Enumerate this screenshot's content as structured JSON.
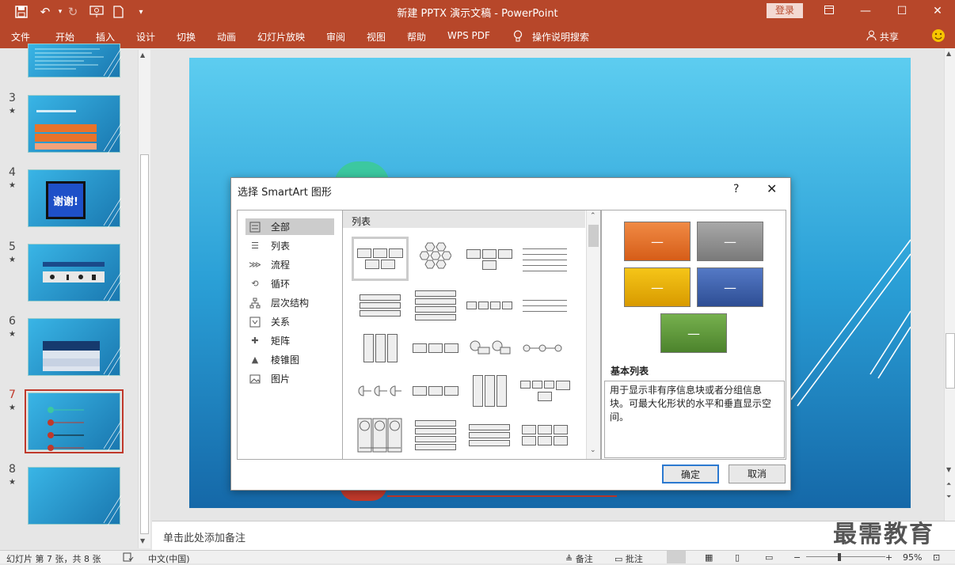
{
  "window": {
    "title": "新建 PPTX 演示文稿 - PowerPoint",
    "login_label": "登录",
    "controls": [
      "ribbon-display-icon",
      "minimize-icon",
      "maximize-icon",
      "close-icon"
    ]
  },
  "quick_access": [
    "save-icon",
    "undo-icon",
    "redo-icon",
    "present-icon",
    "new-icon",
    "customize-icon"
  ],
  "ribbon": {
    "tabs": [
      "文件",
      "开始",
      "插入",
      "设计",
      "切换",
      "动画",
      "幻灯片放映",
      "审阅",
      "视图",
      "帮助",
      "WPS PDF"
    ],
    "search_label": "操作说明搜索",
    "share_label": "共享"
  },
  "slides": [
    {
      "number": "",
      "star": ""
    },
    {
      "number": "3",
      "star": "★"
    },
    {
      "number": "4",
      "star": "★"
    },
    {
      "number": "5",
      "star": "★"
    },
    {
      "number": "6",
      "star": "★"
    },
    {
      "number": "7",
      "star": "★"
    },
    {
      "number": "8",
      "star": "★"
    }
  ],
  "slide_thumb_text": {
    "s4": "谢谢!"
  },
  "notes_placeholder": "单击此处添加备注",
  "status": {
    "slide_info": "幻灯片 第 7 张，共 8 张",
    "language": "中文(中国)",
    "notes_label": "备注",
    "comments_label": "批注",
    "zoom": "95%"
  },
  "watermark": "最需教育",
  "dialog": {
    "title": "选择 SmartArt 图形",
    "help": "?",
    "categories": [
      "全部",
      "列表",
      "流程",
      "循环",
      "层次结构",
      "关系",
      "矩阵",
      "棱锥图",
      "图片"
    ],
    "gallery_header": "列表",
    "preview_name": "基本列表",
    "preview_desc": "用于显示非有序信息块或者分组信息块。可最大化形状的水平和垂直显示空间。",
    "preview_dash": "—",
    "colors": {
      "orange": "#e8732a",
      "gray": "#8f8f8f",
      "gold": "#e8b400",
      "blue": "#3b62b0",
      "green": "#5e9a3c"
    },
    "ok_label": "确定",
    "cancel_label": "取消"
  }
}
